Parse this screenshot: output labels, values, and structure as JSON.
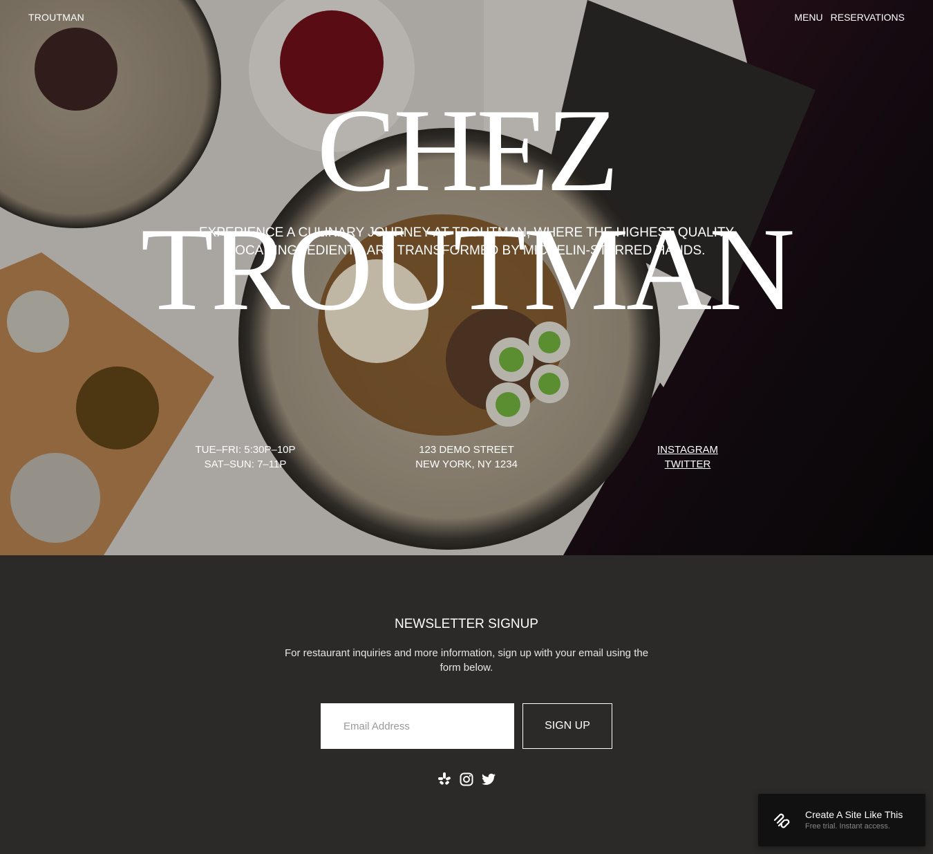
{
  "nav": {
    "brand": "TROUTMAN",
    "links": [
      "MENU",
      "RESERVATIONS"
    ]
  },
  "hero": {
    "title": "CHEZ TROUTMAN",
    "tagline_line1": "EXPERIENCE A CULINARY JOURNEY AT TROUTMAN, WHERE THE HIGHEST QUALITY",
    "tagline_line2": "LOCAL INGREDIENTS ARE TRANSFORMED BY MICHELIN-STARRED HANDS."
  },
  "info": {
    "hours": [
      "TUE–FRI: 5:30P–10P",
      "SAT–SUN: 7–11P"
    ],
    "address": [
      "123 DEMO STREET",
      "NEW YORK, NY 1234"
    ],
    "social_links": [
      "INSTAGRAM",
      "TWITTER"
    ]
  },
  "newsletter": {
    "title": "NEWSLETTER SIGNUP",
    "description": "For restaurant inquiries and more information, sign up with your email using the form below.",
    "email_placeholder": "Email Address",
    "email_value": "",
    "button_label": "SIGN UP"
  },
  "footer_icons": [
    "yelp-icon",
    "instagram-icon",
    "twitter-icon"
  ],
  "badge": {
    "title": "Create A Site Like This",
    "subtitle": "Free trial. Instant access."
  },
  "colors": {
    "footer_bg": "#2b2a29",
    "text": "#ffffff",
    "badge_bg": "#111111"
  }
}
